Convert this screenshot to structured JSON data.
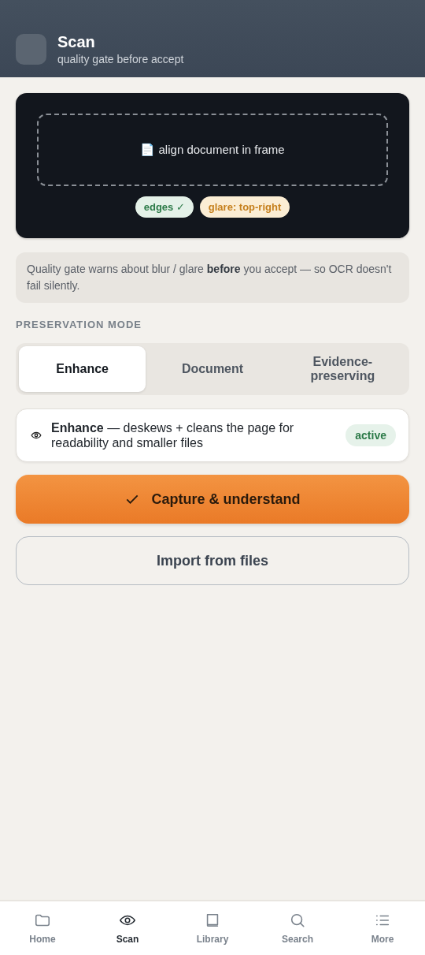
{
  "header": {
    "title": "Scan",
    "subtitle": "quality gate before accept"
  },
  "viewfinder": {
    "hint": "📄 align document in frame",
    "chips": [
      {
        "label": "edges ✓",
        "kind": "ok"
      },
      {
        "label": "glare: top-right",
        "kind": "warn"
      }
    ]
  },
  "notice": "Quality gate warns about blur / glare **before** you accept — so OCR doesn't fail silently.",
  "section_label": "PRESERVATION MODE",
  "modes": [
    {
      "label": "Enhance",
      "selected": true
    },
    {
      "label": "Document",
      "selected": false
    },
    {
      "label": "Evidence-preserving",
      "selected": false
    }
  ],
  "mode_info": {
    "text": "**Enhance** — deskews + cleans the page for readability and smaller files",
    "badge": "active"
  },
  "buttons": [
    {
      "label": "Capture & understand",
      "kind": "primary"
    },
    {
      "label": "Import from files",
      "kind": "secondary"
    }
  ],
  "nav": [
    {
      "label": "Home",
      "selected": false
    },
    {
      "label": "Scan",
      "selected": true
    },
    {
      "label": "Library",
      "selected": false
    },
    {
      "label": "Search",
      "selected": false
    },
    {
      "label": "More",
      "selected": false
    }
  ]
}
